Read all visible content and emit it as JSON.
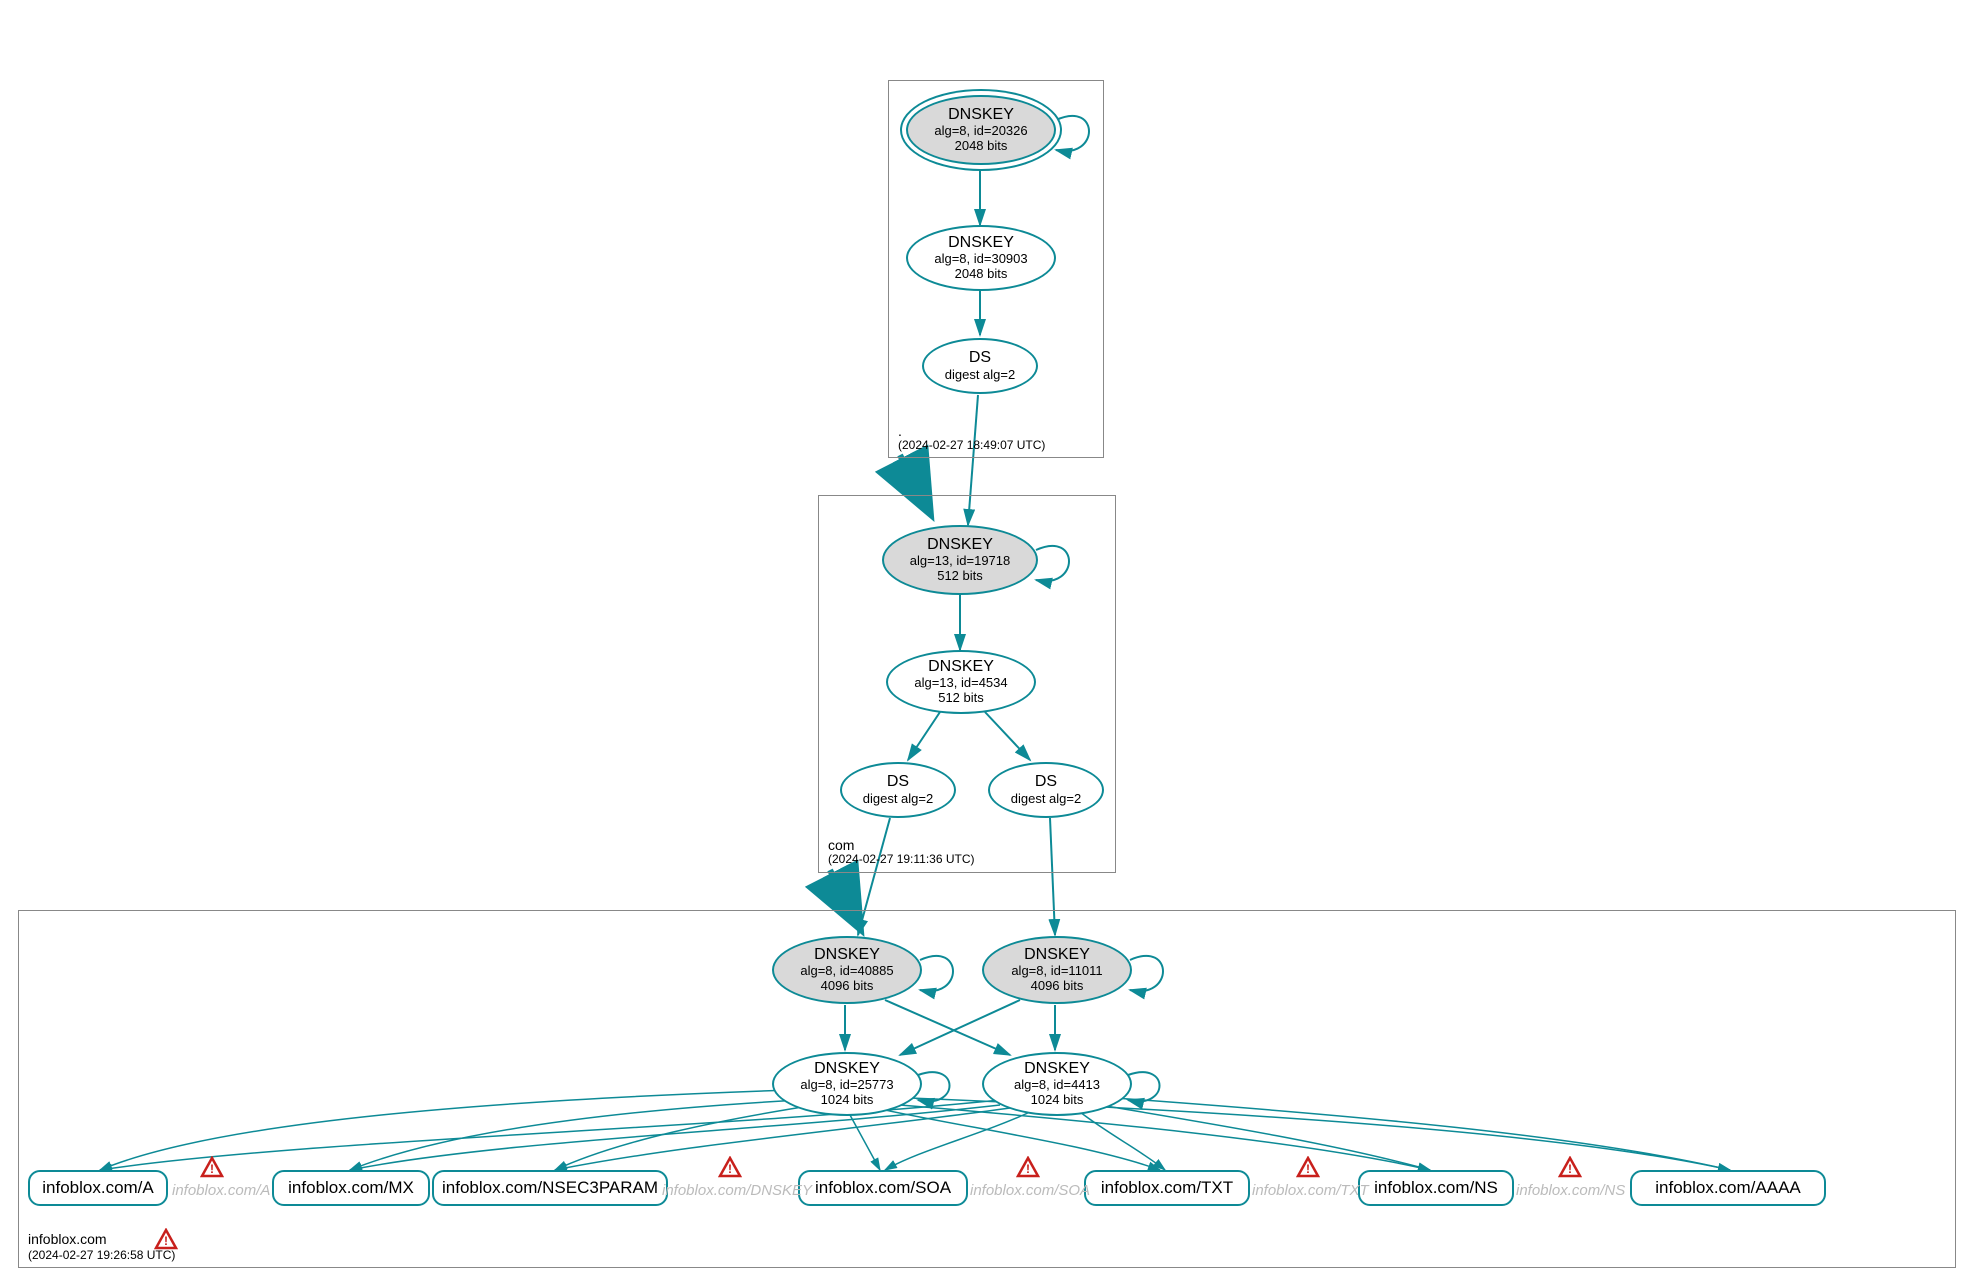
{
  "colors": {
    "edge": "#0d8a96",
    "warn_red": "#c8201c",
    "gray_fill": "#d9d9d9"
  },
  "zones": {
    "root": {
      "name": ".",
      "timestamp": "(2024-02-27 18:49:07 UTC)"
    },
    "com": {
      "name": "com",
      "timestamp": "(2024-02-27 19:11:36 UTC)"
    },
    "infoblox": {
      "name": "infoblox.com",
      "timestamp": "(2024-02-27 19:26:58 UTC)"
    }
  },
  "nodes": {
    "root_ksk": {
      "type": "DNSKEY",
      "detail": "alg=8, id=20326",
      "bits": "2048 bits"
    },
    "root_zsk": {
      "type": "DNSKEY",
      "detail": "alg=8, id=30903",
      "bits": "2048 bits"
    },
    "root_ds": {
      "type": "DS",
      "detail": "digest alg=2"
    },
    "com_ksk": {
      "type": "DNSKEY",
      "detail": "alg=13, id=19718",
      "bits": "512 bits"
    },
    "com_zsk": {
      "type": "DNSKEY",
      "detail": "alg=13, id=4534",
      "bits": "512 bits"
    },
    "com_ds1": {
      "type": "DS",
      "detail": "digest alg=2"
    },
    "com_ds2": {
      "type": "DS",
      "detail": "digest alg=2"
    },
    "ib_ksk1": {
      "type": "DNSKEY",
      "detail": "alg=8, id=40885",
      "bits": "4096 bits"
    },
    "ib_ksk2": {
      "type": "DNSKEY",
      "detail": "alg=8, id=11011",
      "bits": "4096 bits"
    },
    "ib_zsk1": {
      "type": "DNSKEY",
      "detail": "alg=8, id=25773",
      "bits": "1024 bits"
    },
    "ib_zsk2": {
      "type": "DNSKEY",
      "detail": "alg=8, id=4413",
      "bits": "1024 bits"
    }
  },
  "rrsets": {
    "a": "infoblox.com/A",
    "mx": "infoblox.com/MX",
    "nsec3": "infoblox.com/NSEC3PARAM",
    "soa": "infoblox.com/SOA",
    "txt": "infoblox.com/TXT",
    "ns": "infoblox.com/NS",
    "aaaa": "infoblox.com/AAAA"
  },
  "ghost_rrsets": {
    "a": "infoblox.com/A",
    "dnskey": "infoblox.com/DNSKEY",
    "soa": "infoblox.com/SOA",
    "txt": "infoblox.com/TXT",
    "ns": "infoblox.com/NS"
  }
}
